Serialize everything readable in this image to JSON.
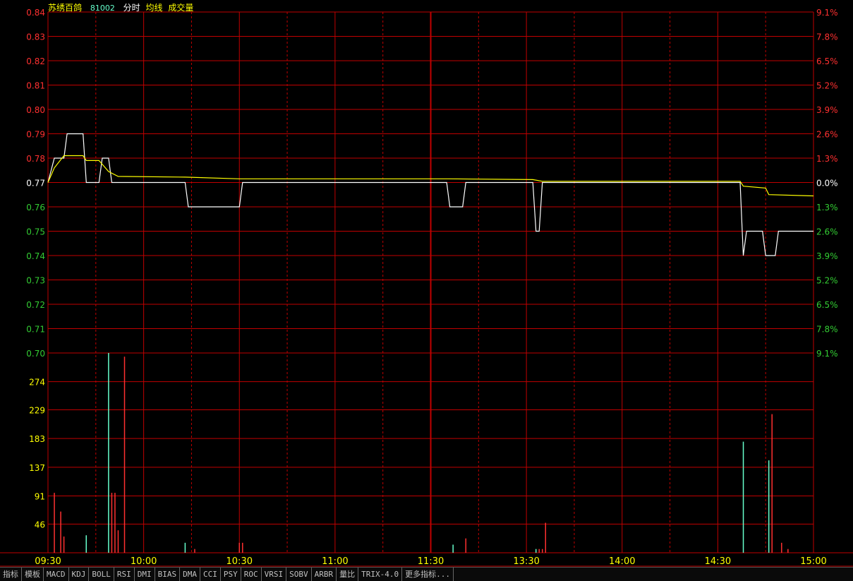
{
  "header": {
    "name": "苏绣百鸽",
    "code": "81002",
    "tags": [
      "分时",
      "均线",
      "成交量"
    ]
  },
  "colors": {
    "up": "#ff3030",
    "down": "#33cc33",
    "neutral": "#ffffff",
    "volume_axis": "#ffff00",
    "grid": "#c00000",
    "price_line": "#ffffff",
    "avg_line": "#ffff00",
    "time_label": "#ffff00",
    "vol_up": "#ff3030",
    "vol_down": "#66ffcc"
  },
  "toolbar": [
    "指标",
    "模板",
    "MACD",
    "KDJ",
    "BOLL",
    "RSI",
    "DMI",
    "BIAS",
    "DMA",
    "CCI",
    "PSY",
    "ROC",
    "VRSI",
    "SOBV",
    "ARBR",
    "量比",
    "TRIX-4.0",
    "更多指标..."
  ],
  "chart_data": [
    {
      "type": "line",
      "title": "分时",
      "prev_close": 0.77,
      "ylim": [
        0.7,
        0.84
      ],
      "y_ticks": [
        "0.84",
        "0.83",
        "0.82",
        "0.81",
        "0.80",
        "0.79",
        "0.78",
        "0.77",
        "0.76",
        "0.75",
        "0.74",
        "0.73",
        "0.72",
        "0.71",
        "0.70"
      ],
      "right_ticks": [
        "9.1%",
        "7.8%",
        "6.5%",
        "5.2%",
        "3.9%",
        "2.6%",
        "1.3%",
        "0.0%",
        "1.3%",
        "2.6%",
        "3.9%",
        "5.2%",
        "6.5%",
        "7.8%",
        "9.1%"
      ],
      "x_labels": [
        "09:30",
        "10:00",
        "10:30",
        "11:00",
        "11:30",
        "13:30",
        "14:00",
        "14:30",
        "15:00"
      ],
      "series": [
        {
          "name": "分时",
          "points": [
            [
              0,
              0.77
            ],
            [
              2,
              0.78
            ],
            [
              5,
              0.78
            ],
            [
              6,
              0.79
            ],
            [
              11,
              0.79
            ],
            [
              12,
              0.77
            ],
            [
              16,
              0.77
            ],
            [
              17,
              0.78
            ],
            [
              19,
              0.78
            ],
            [
              20,
              0.77
            ],
            [
              43,
              0.77
            ],
            [
              44,
              0.76
            ],
            [
              60,
              0.76
            ],
            [
              61,
              0.77
            ],
            [
              125,
              0.77
            ],
            [
              126,
              0.76
            ],
            [
              130,
              0.76
            ],
            [
              131,
              0.77
            ],
            [
              152,
              0.77
            ],
            [
              153,
              0.75
            ],
            [
              154,
              0.75
            ],
            [
              155,
              0.77
            ],
            [
              217,
              0.77
            ],
            [
              218,
              0.74
            ],
            [
              219,
              0.75
            ],
            [
              224,
              0.75
            ],
            [
              225,
              0.74
            ],
            [
              228,
              0.74
            ],
            [
              229,
              0.75
            ],
            [
              240,
              0.75
            ]
          ]
        },
        {
          "name": "均线",
          "points": [
            [
              0,
              0.77
            ],
            [
              2,
              0.776
            ],
            [
              5,
              0.781
            ],
            [
              11,
              0.781
            ],
            [
              12,
              0.779
            ],
            [
              16,
              0.779
            ],
            [
              19,
              0.7745
            ],
            [
              22,
              0.7725
            ],
            [
              43,
              0.7722
            ],
            [
              60,
              0.7715
            ],
            [
              125,
              0.7715
            ],
            [
              152,
              0.7712
            ],
            [
              155,
              0.7705
            ],
            [
              217,
              0.7705
            ],
            [
              218,
              0.7685
            ],
            [
              225,
              0.7677
            ],
            [
              226,
              0.765
            ],
            [
              240,
              0.7645
            ]
          ]
        }
      ]
    },
    {
      "type": "bar",
      "title": "成交量",
      "ylim": [
        0,
        320
      ],
      "y_ticks": [
        "274",
        "229",
        "183",
        "137",
        "91",
        "46"
      ],
      "bars": [
        {
          "t": 2,
          "v": 96,
          "dir": "up"
        },
        {
          "t": 4,
          "v": 66,
          "dir": "up"
        },
        {
          "t": 5,
          "v": 26,
          "dir": "up"
        },
        {
          "t": 12,
          "v": 28,
          "dir": "down"
        },
        {
          "t": 19,
          "v": 320,
          "dir": "down"
        },
        {
          "t": 20,
          "v": 96,
          "dir": "up"
        },
        {
          "t": 21,
          "v": 96,
          "dir": "up"
        },
        {
          "t": 22,
          "v": 36,
          "dir": "up"
        },
        {
          "t": 24,
          "v": 314,
          "dir": "up"
        },
        {
          "t": 43,
          "v": 16,
          "dir": "down"
        },
        {
          "t": 46,
          "v": 6,
          "dir": "up"
        },
        {
          "t": 60,
          "v": 16,
          "dir": "up"
        },
        {
          "t": 61,
          "v": 16,
          "dir": "up"
        },
        {
          "t": 127,
          "v": 13,
          "dir": "down"
        },
        {
          "t": 131,
          "v": 23,
          "dir": "up"
        },
        {
          "t": 153,
          "v": 6,
          "dir": "down"
        },
        {
          "t": 154,
          "v": 6,
          "dir": "up"
        },
        {
          "t": 155,
          "v": 6,
          "dir": "up"
        },
        {
          "t": 156,
          "v": 48,
          "dir": "up"
        },
        {
          "t": 218,
          "v": 178,
          "dir": "down"
        },
        {
          "t": 226,
          "v": 148,
          "dir": "down"
        },
        {
          "t": 227,
          "v": 222,
          "dir": "up"
        },
        {
          "t": 230,
          "v": 16,
          "dir": "up"
        },
        {
          "t": 232,
          "v": 6,
          "dir": "up"
        }
      ]
    }
  ]
}
